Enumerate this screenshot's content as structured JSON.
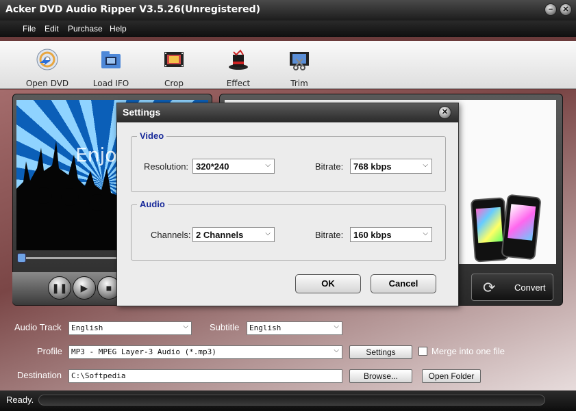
{
  "window": {
    "title": "Acker DVD Audio Ripper V3.5.26(Unregistered)",
    "min_label": "−",
    "close_label": "✕"
  },
  "menu": [
    "File",
    "Edit",
    "Purchase",
    "Help"
  ],
  "toolbar": [
    {
      "label": "Open DVD",
      "icon": "dvd-disc-icon"
    },
    {
      "label": "Load IFO",
      "icon": "folder-film-icon"
    },
    {
      "label": "Crop",
      "icon": "film-crop-icon"
    },
    {
      "label": "Effect",
      "icon": "magic-hat-icon"
    },
    {
      "label": "Trim",
      "icon": "film-scissors-icon"
    }
  ],
  "preview": {
    "watermark": "Enjoy"
  },
  "convert": {
    "label": "Convert",
    "icon": "convert-arrows-icon"
  },
  "dialog": {
    "title": "Settings",
    "video": {
      "legend": "Video",
      "resolution_label": "Resolution:",
      "resolution_value": "320*240",
      "bitrate_label": "Bitrate:",
      "bitrate_value": "768 kbps"
    },
    "audio": {
      "legend": "Audio",
      "channels_label": "Channels:",
      "channels_value": "2 Channels",
      "bitrate_label": "Bitrate:",
      "bitrate_value": "160 kbps"
    },
    "ok_label": "OK",
    "cancel_label": "Cancel"
  },
  "bottom": {
    "audio_track_label": "Audio Track",
    "audio_track_value": "English",
    "subtitle_label": "Subtitle",
    "subtitle_value": "English",
    "profile_label": "Profile",
    "profile_value": "MP3 - MPEG Layer-3 Audio (*.mp3)",
    "settings_button": "Settings",
    "merge_label": "Merge into one file",
    "destination_label": "Destination",
    "destination_value": "C:\\Softpedia",
    "browse_button": "Browse...",
    "open_folder_button": "Open Folder"
  },
  "status": {
    "text": "Ready."
  },
  "colors": {
    "accent_blue": "#1a2b9a",
    "chrome_dark": "#1c1c1c",
    "background": "#7a4646"
  }
}
